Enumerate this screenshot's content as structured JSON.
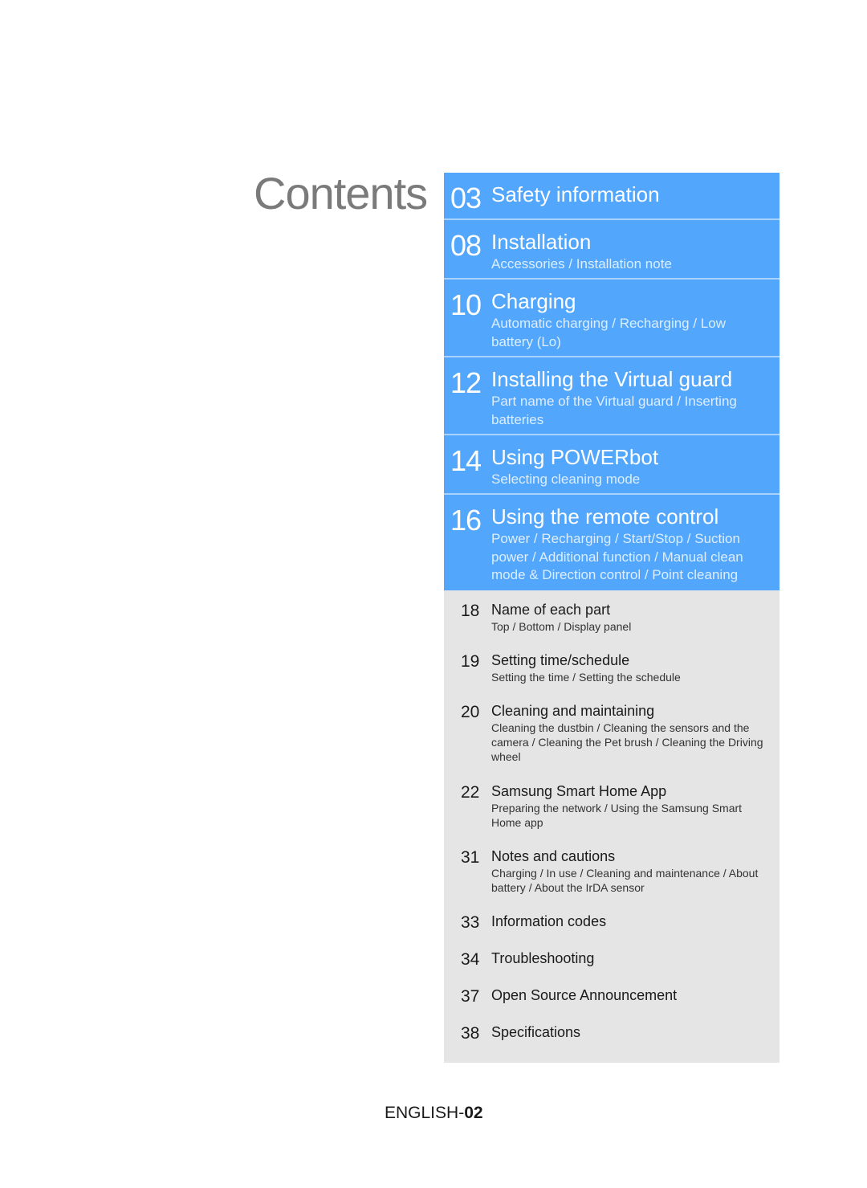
{
  "page": {
    "title": "Contents",
    "footer_prefix": "ENGLISH-",
    "footer_page": "02"
  },
  "colors": {
    "blue_section": "#52a6fc",
    "gray_section": "#e5e5e5",
    "title": "#7a7a7a"
  },
  "blue_sections": [
    {
      "page": "03",
      "title": "Safety information",
      "sub": ""
    },
    {
      "page": "08",
      "title": "Installation",
      "sub": "Accessories / Installation note"
    },
    {
      "page": "10",
      "title": "Charging",
      "sub": "Automatic charging / Recharging / Low battery (Lo)"
    },
    {
      "page": "12",
      "title": "Installing the Virtual guard",
      "sub": "Part name of the Virtual guard / Inserting batteries"
    },
    {
      "page": "14",
      "title": "Using POWERbot",
      "sub": "Selecting cleaning mode"
    },
    {
      "page": "16",
      "title": "Using the remote control",
      "sub": "Power / Recharging / Start/Stop / Suction power / Additional function / Manual clean mode & Direction control / Point cleaning"
    }
  ],
  "gray_sections": [
    {
      "page": "18",
      "title": "Name of each part",
      "sub": "Top / Bottom / Display panel"
    },
    {
      "page": "19",
      "title": "Setting time/schedule",
      "sub": "Setting the time / Setting the schedule"
    },
    {
      "page": "20",
      "title": "Cleaning and maintaining",
      "sub": "Cleaning the dustbin / Cleaning the sensors and the camera / Cleaning the Pet brush / Cleaning the Driving wheel"
    },
    {
      "page": "22",
      "title": "Samsung Smart Home App",
      "sub": "Preparing the network / Using the Samsung Smart Home app"
    },
    {
      "page": "31",
      "title": "Notes and cautions",
      "sub": "Charging / In use / Cleaning and maintenance / About battery / About the IrDA sensor"
    },
    {
      "page": "33",
      "title": "Information codes",
      "sub": ""
    },
    {
      "page": "34",
      "title": "Troubleshooting",
      "sub": ""
    },
    {
      "page": "37",
      "title": "Open Source Announcement",
      "sub": ""
    },
    {
      "page": "38",
      "title": "Specifications",
      "sub": ""
    }
  ]
}
